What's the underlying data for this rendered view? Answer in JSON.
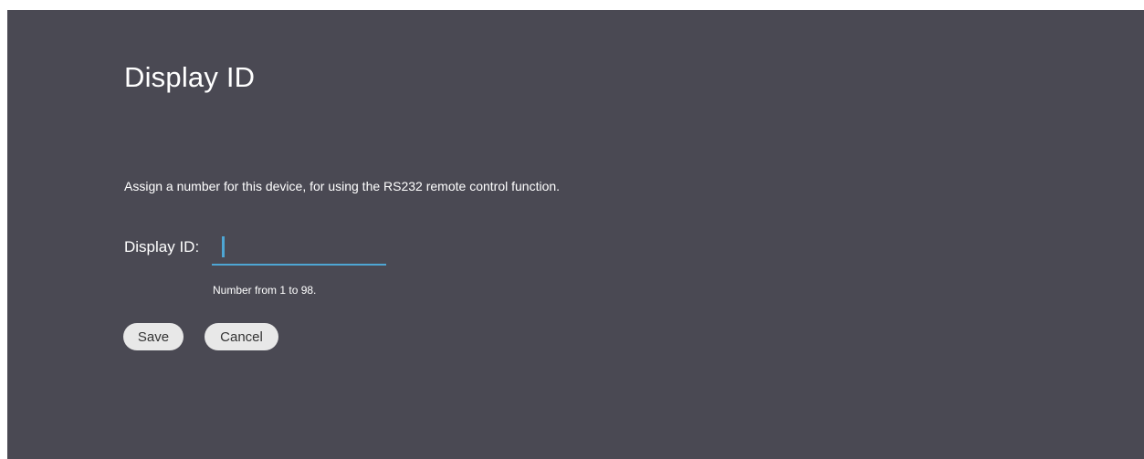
{
  "page": {
    "title": "Display ID",
    "description": "Assign a number for this device, for using the RS232 remote control function."
  },
  "display_id_field": {
    "label": "Display ID:",
    "value": "",
    "hint": "Number from 1 to 98."
  },
  "buttons": {
    "save": "Save",
    "cancel": "Cancel"
  },
  "colors": {
    "background": "#4a4953",
    "accent": "#4ea6d4",
    "button_fill": "#e8e8e8",
    "text": "#ffffff"
  }
}
